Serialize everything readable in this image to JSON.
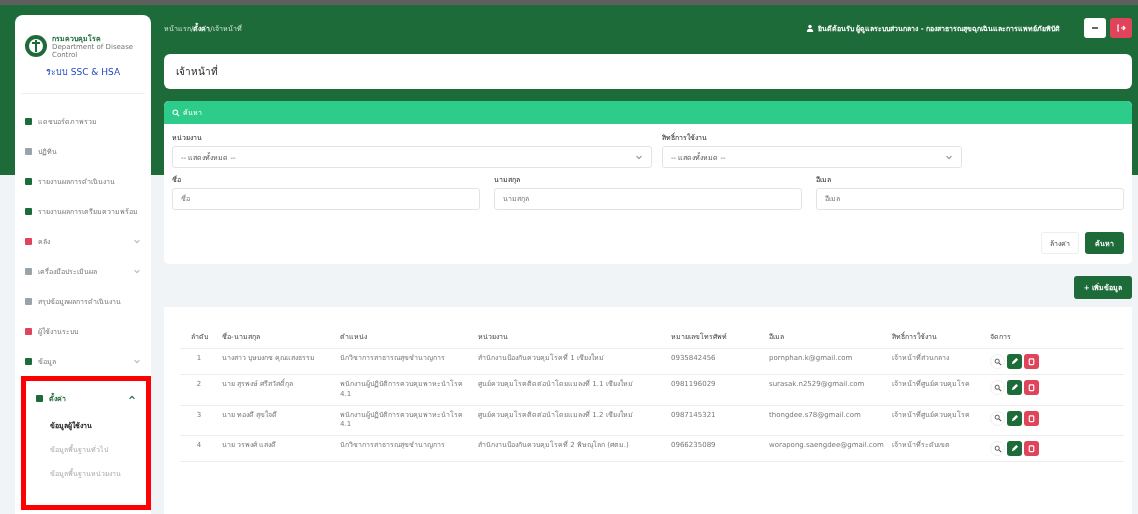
{
  "sidebar": {
    "org": "กรมควบคุมโรค",
    "org_sub": "Department of Disease Control",
    "system": "ระบบ SSC & HSA",
    "items": [
      {
        "label": "แดชบอร์ดภาพรวม",
        "color": "#1e6b3a",
        "selected": false
      },
      {
        "label": "ปฏิทิน",
        "color": "#9aa3a8",
        "selected": false
      },
      {
        "label": "รายงานผลการดำเนินงาน",
        "color": "#1e6b3a",
        "selected": false
      },
      {
        "label": "รายงานผลการเตรียมความพร้อม",
        "color": "#1e6b3a",
        "selected": false
      },
      {
        "label": "คลัง",
        "color": "#e0445a",
        "expanded": false,
        "selected": false
      },
      {
        "label": "เครื่องมือประเมินผล",
        "color": "#9aa3a8",
        "expanded": false,
        "selected": false
      },
      {
        "label": "สรุปข้อมูลผลการดำเนินงาน",
        "color": "#9aa3a8",
        "selected": false
      },
      {
        "label": "ผู้ใช้งานระบบ",
        "color": "#e0445a",
        "selected": false
      },
      {
        "label": "ข้อมูล",
        "color": "#1e6b3a",
        "expanded": false,
        "selected": false
      },
      {
        "label": "ตั้งค่า",
        "color": "#1e6b3a",
        "expanded": true,
        "selected": true,
        "highlighted": true,
        "children": [
          {
            "label": "ข้อมูลผู้ใช้งาน",
            "selected": true
          },
          {
            "label": "ข้อมูลพื้นฐานทั่วไป",
            "selected": false
          },
          {
            "label": "ข้อมูลพื้นฐานหน่วยงาน",
            "selected": false
          }
        ]
      }
    ]
  },
  "topbar": {
    "breadcrumb": [
      "หน้าแรก",
      "ตั้งค่า",
      "เจ้าหน้าที่"
    ],
    "separator": "/",
    "user": "ยินดีต้อนรับ ผู้ดูแลระบบส่วนกลาง - กองสาธารณสุขฉุกเฉินและการแพทย์ภัยพิบัติ"
  },
  "page_title": "เจ้าหน้าที่",
  "search": {
    "title": "ค้นหา",
    "selects": [
      {
        "label": "หน่วยงาน",
        "value": "-- แสดงทั้งหมด --"
      },
      {
        "label": "สิทธิ์การใช้งาน",
        "value": "-- แสดงทั้งหมด --"
      }
    ],
    "inputs": [
      {
        "label": "ชื่อ",
        "placeholder": "ชื่อ"
      },
      {
        "label": "นามสกุล",
        "placeholder": "นามสกุล"
      },
      {
        "label": "อีเมล",
        "placeholder": "อีเมล"
      }
    ],
    "reset_button": "ล้างค่า",
    "search_button": "ค้นหา"
  },
  "add_button": "+ เพิ่มข้อมูล",
  "table": {
    "columns": [
      "ลำดับ",
      "ชื่อ-นามสกุล",
      "ตำแหน่ง",
      "หน่วยงาน",
      "หมายเลขโทรศัพท์",
      "อีเมล",
      "สิทธิ์การใช้งาน",
      "จัดการ"
    ],
    "rows": [
      [
        "1",
        "นางสาว บุษบงกช คุณแสงธรรม",
        "นักวิชาการสาธารณสุขชำนาญการ",
        "สำนักงานป้องกันควบคุมโรคที่ 1 เชียงใหม่",
        "0935842456",
        "pornphan.k@gmail.com",
        "เจ้าหน้าที่ส่วนกลาง"
      ],
      [
        "2",
        "นาย สุรพงษ์ ศรีสวัสดิ์กุล",
        "พนักงานผู้ปฏิบัติการควบคุมพาหะนำโรค 4.1",
        "ศูนย์ควบคุมโรคติดต่อนำโดยแมลงที่ 1.1 เชียงใหม่",
        "0981196029",
        "surasak.n2529@gmail.com",
        "เจ้าหน้าที่ศูนย์ควบคุมโรค"
      ],
      [
        "3",
        "นาย ทองดี สุขใจดี",
        "พนักงานผู้ปฏิบัติการควบคุมพาหะนำโรค 4.1",
        "ศูนย์ควบคุมโรคติดต่อนำโดยแมลงที่ 1.2 เชียงใหม่",
        "0987145321",
        "thongdee.s78@gmail.com",
        "เจ้าหน้าที่ศูนย์ควบคุมโรค"
      ],
      [
        "4",
        "นาย วรพงศ์ แสงดี",
        "นักวิชาการสาธารณสุขชำนาญการ",
        "สำนักงานป้องกันควบคุมโรคที่ 2 พิษณุโลก (ศตม.)",
        "0966235089",
        "worapong.saengdee@gmail.com",
        "เจ้าหน้าที่ระดับเขต"
      ]
    ]
  }
}
